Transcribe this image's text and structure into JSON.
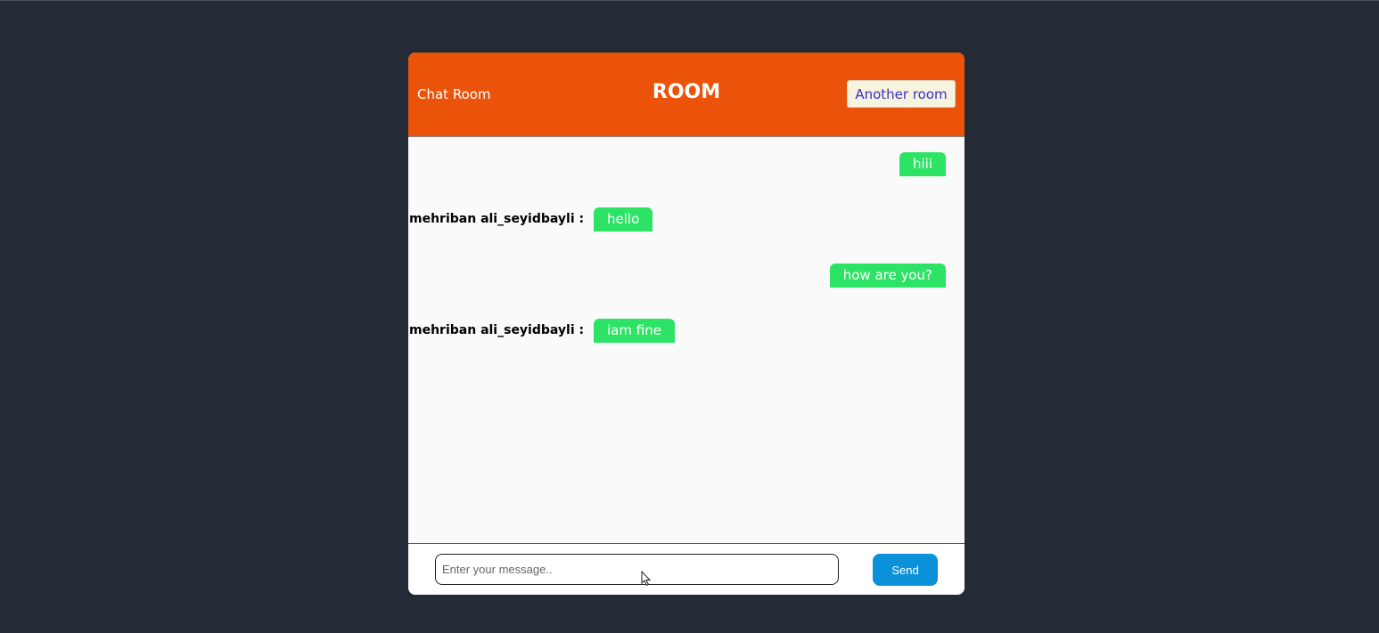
{
  "header": {
    "left_label": "Chat Room",
    "title": "ROOM",
    "another_room_label": "Another room"
  },
  "messages": [
    {
      "side": "right",
      "text": "hiii"
    },
    {
      "side": "left",
      "sender": "mehriban ali_seyidbayli :",
      "text": "hello"
    },
    {
      "side": "right",
      "text": "how are you?"
    },
    {
      "side": "left",
      "sender": "mehriban ali_seyidbayli :",
      "text": "iam fine"
    }
  ],
  "footer": {
    "input_placeholder": "Enter your message..",
    "input_value": "",
    "send_label": "Send"
  },
  "colors": {
    "page_bg": "#242b36",
    "header_bg": "#ec530a",
    "bubble_bg": "#2de365",
    "send_bg": "#0a91d8",
    "another_room_text": "#3a31c6"
  },
  "icons": {
    "pointer": "mouse-pointer-icon"
  }
}
